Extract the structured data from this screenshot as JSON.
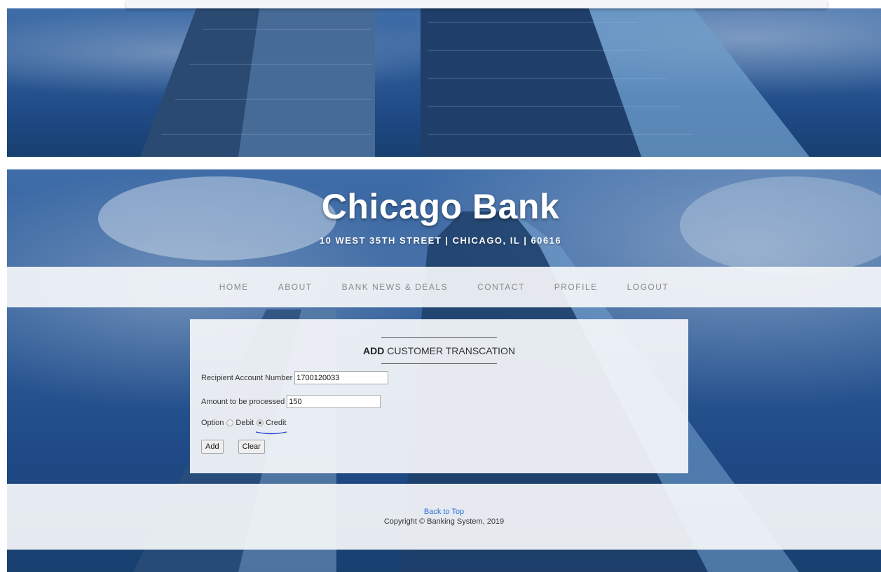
{
  "header": {
    "title": "Chicago Bank",
    "address": "10 WEST 35TH STREET | CHICAGO, IL | 60616"
  },
  "nav": {
    "items": [
      "HOME",
      "ABOUT",
      "BANK NEWS & DEALS",
      "CONTACT",
      "PROFILE",
      "LOGOUT"
    ]
  },
  "form": {
    "heading_bold": "ADD",
    "heading_rest": "CUSTOMER TRANSCATION",
    "recipient_label": "Recipient Account Number",
    "recipient_value": "1700120033",
    "amount_label": "Amount to be processed",
    "amount_value": "150",
    "option_label": "Option",
    "debit_label": "Debit",
    "credit_label": "Credit",
    "selected_option": "Credit",
    "add_label": "Add",
    "clear_label": "Clear"
  },
  "footer": {
    "back_to_top": "Back to Top",
    "copyright": "Copyright © Banking System, 2019"
  },
  "colors": {
    "link": "#2a6fd6",
    "sky": "#2f5d99",
    "panel": "#f5f7fa"
  }
}
